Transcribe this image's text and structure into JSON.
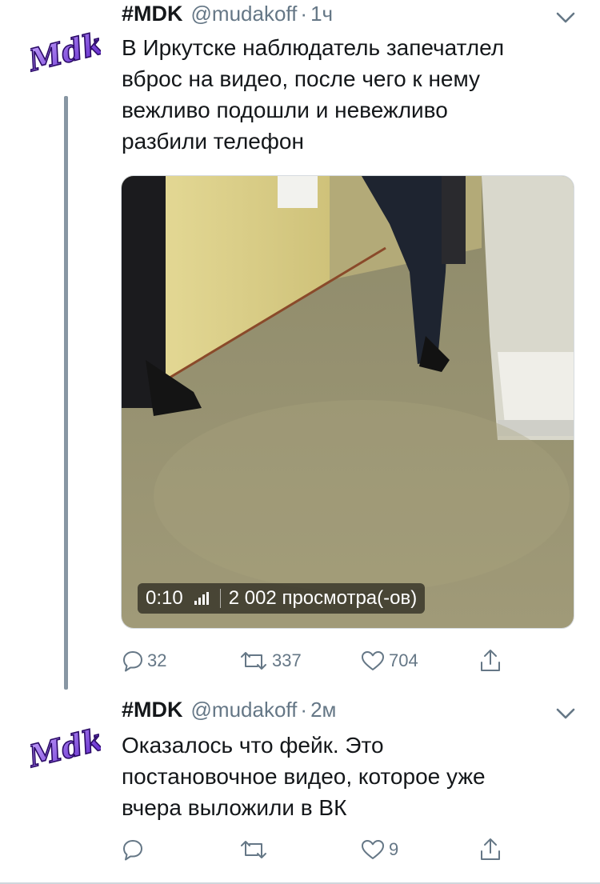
{
  "tweets": [
    {
      "name": "#MDK",
      "handle": "@mudakoff",
      "separator": "·",
      "time": "1ч",
      "avatar_text": "Mdk",
      "text_lines": [
        "В Иркутске наблюдатель запечатлел",
        "вброс на видео, после чего к нему",
        "вежливо подошли и невежливо",
        "разбили телефон"
      ],
      "video": {
        "duration": "0:10",
        "views": "2 002 просмотра(-ов)"
      },
      "actions": {
        "reply_count": "32",
        "retweet_count": "337",
        "like_count": "704"
      }
    },
    {
      "name": "#MDK",
      "handle": "@mudakoff",
      "separator": "·",
      "time": "2м",
      "avatar_text": "Mdk",
      "text_lines": [
        "Оказалось что фейк. Это",
        "постановочное видео, которое уже",
        "вчера выложили в ВК"
      ],
      "actions": {
        "reply_count": "",
        "retweet_count": "",
        "like_count": "9"
      }
    }
  ],
  "colors": {
    "text": "#14171a",
    "secondary": "#657786",
    "thread_line": "#8796a3",
    "logo_purple": "#6b2fd6"
  },
  "icons": [
    "mdk-logo-icon",
    "chevron-down-icon",
    "reply-icon",
    "retweet-icon",
    "like-icon",
    "share-icon",
    "views-bars-icon"
  ]
}
